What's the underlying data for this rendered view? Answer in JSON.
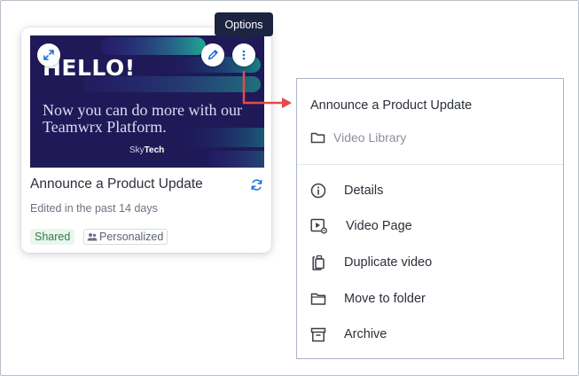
{
  "tooltip": {
    "label": "Options"
  },
  "card": {
    "thumbnail": {
      "headline": "HELLO!",
      "tagline": "Now you can do more with our Teamwrx Platform.",
      "brand_prefix": "Sky",
      "brand_suffix": "Tech"
    },
    "title": "Announce a Product Update",
    "subtitle": "Edited in the past 14 days",
    "badges": {
      "shared": "Shared",
      "personalized": "Personalized"
    },
    "icons": {
      "expand": "expand-icon",
      "edit": "pencil-icon",
      "options": "kebab-icon",
      "sync": "sync-icon"
    }
  },
  "menu": {
    "title": "Announce a Product Update",
    "library": "Video Library",
    "items": [
      {
        "label": "Details",
        "icon": "info-icon"
      },
      {
        "label": "Video Page",
        "icon": "video-page-icon"
      },
      {
        "label": "Duplicate video",
        "icon": "duplicate-icon"
      },
      {
        "label": "Move to folder",
        "icon": "folder-icon"
      },
      {
        "label": "Archive",
        "icon": "archive-icon"
      }
    ]
  },
  "colors": {
    "accent": "#1f6fd1",
    "annotation": "#e5484d",
    "tooltip_bg": "#1c2540",
    "thumb_bg": "#1f1a57"
  }
}
